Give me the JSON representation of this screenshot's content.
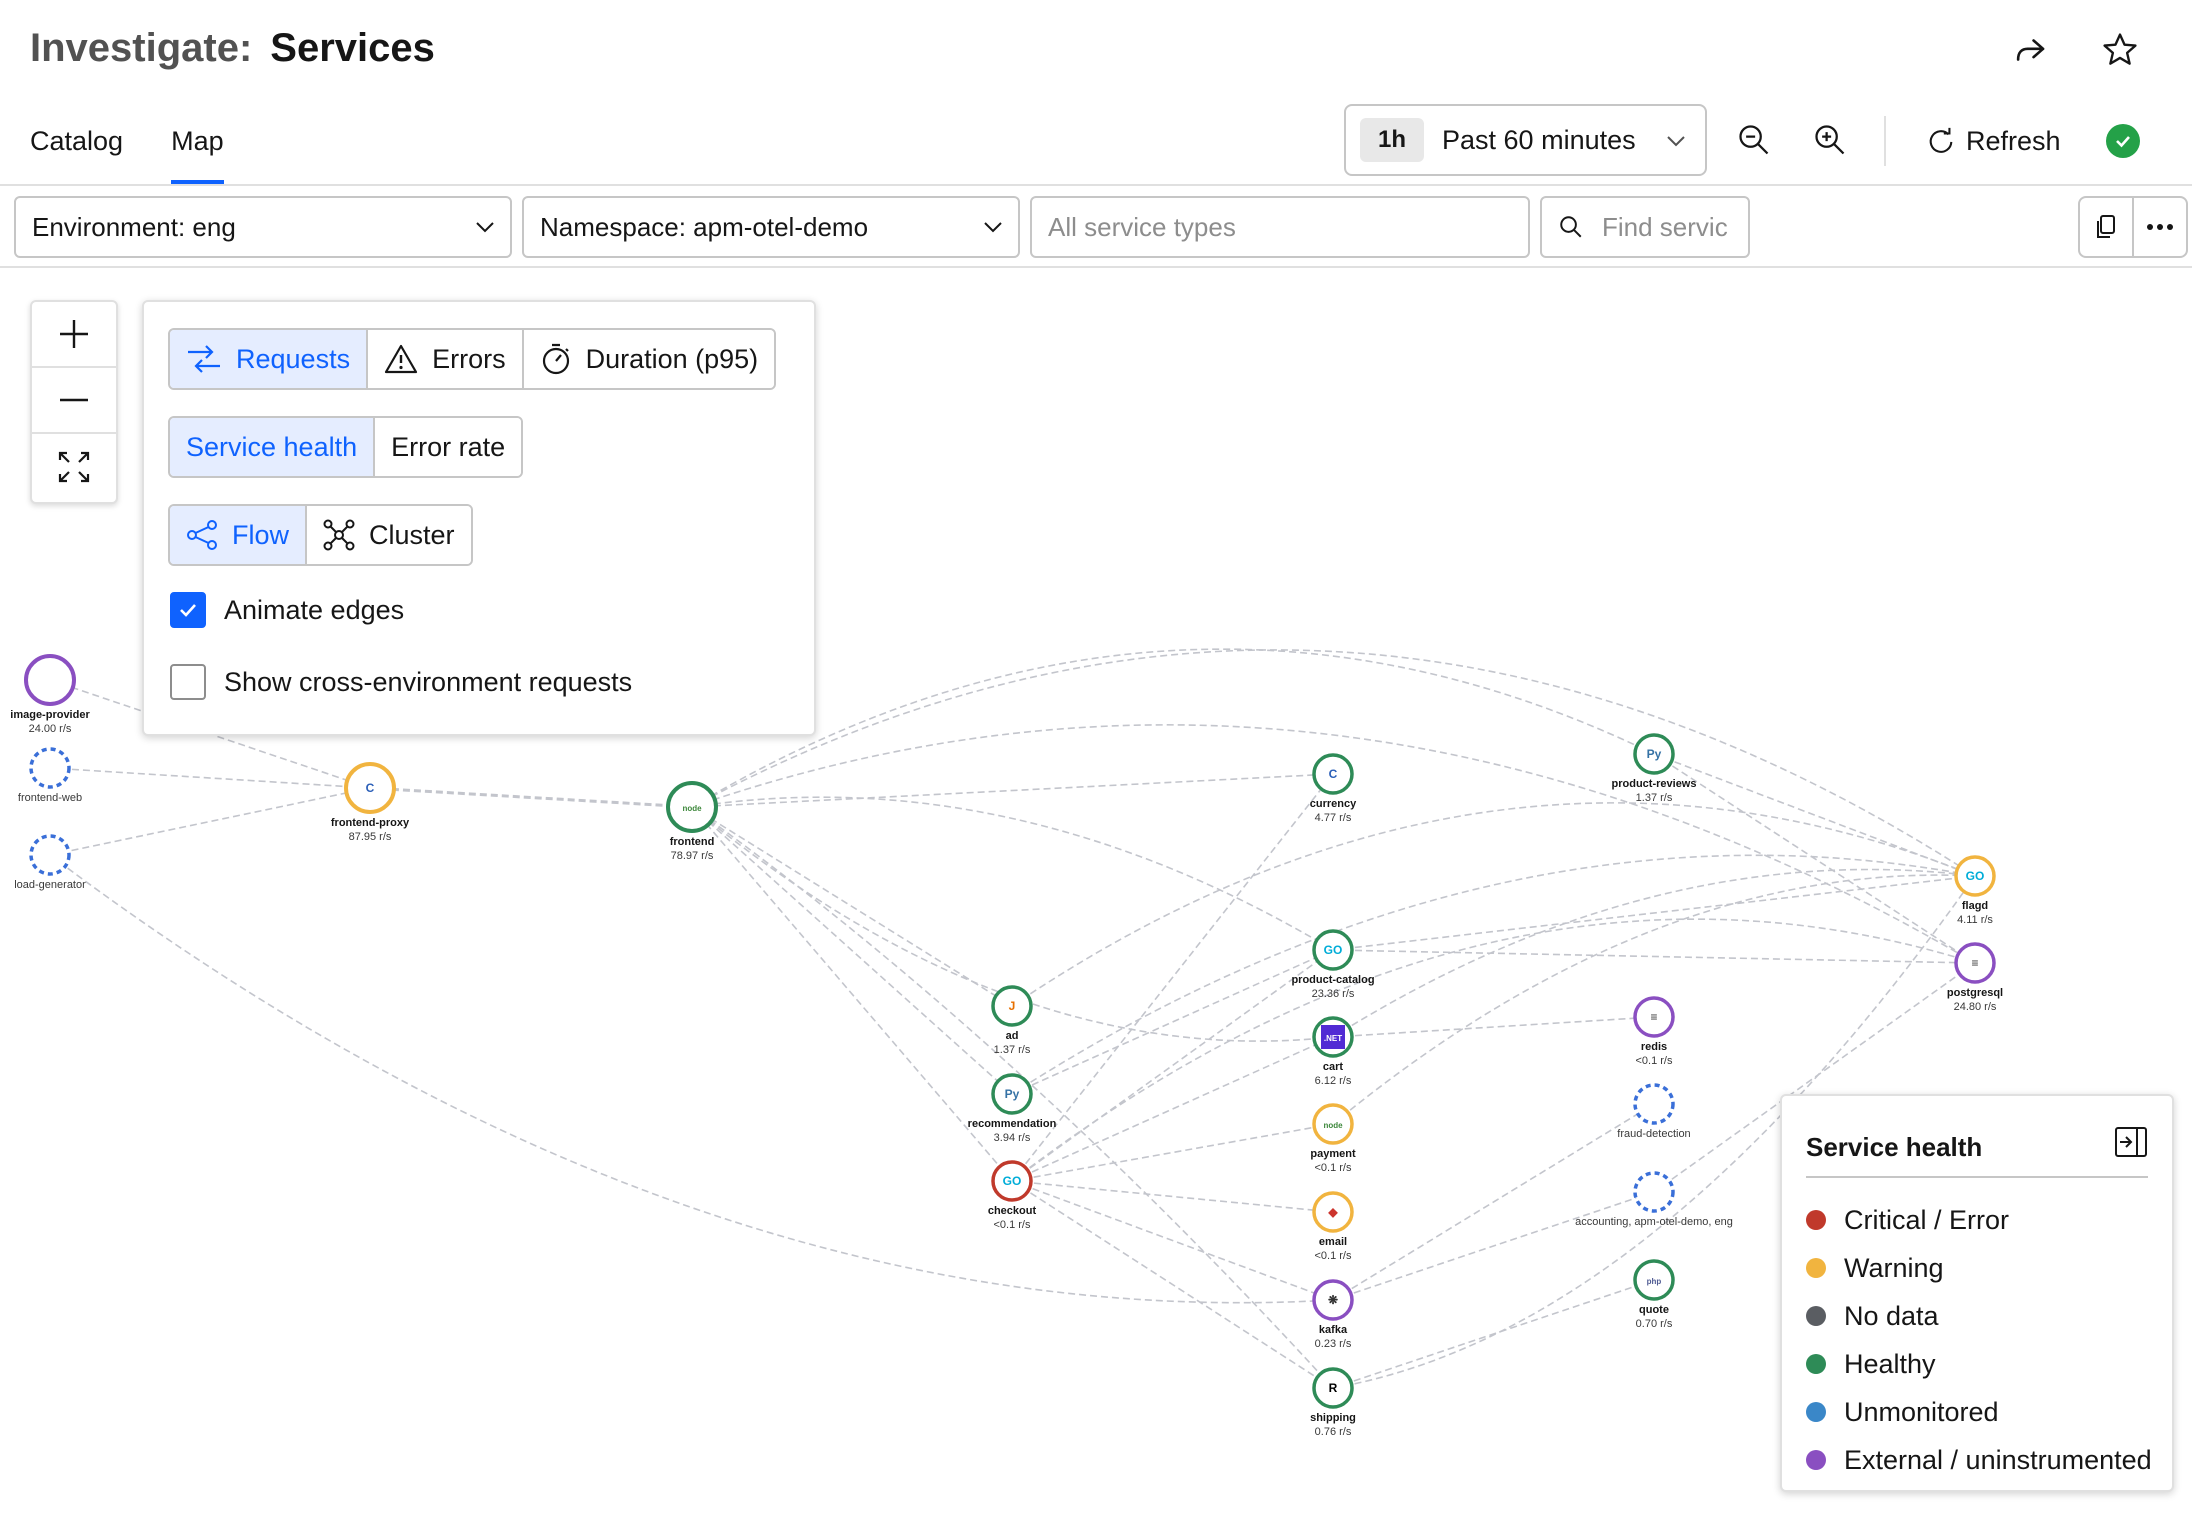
{
  "header": {
    "title_prefix": "Investigate:",
    "title_main": "Services",
    "share_icon": "share-icon",
    "star_icon": "star-icon"
  },
  "tabs": [
    {
      "label": "Catalog",
      "active": false
    },
    {
      "label": "Map",
      "active": true
    }
  ],
  "toolbar": {
    "time_chip": "1h",
    "time_range": "Past 60 minutes",
    "zoom_out_icon": "zoom-out-icon",
    "zoom_in_icon": "zoom-in-icon",
    "refresh_label": "Refresh",
    "status": "healthy"
  },
  "filters": {
    "environment": "Environment: eng",
    "namespace": "Namespace: apm-otel-demo",
    "service_types_placeholder": "All service types",
    "find_placeholder": "Find servic"
  },
  "map_controls": {
    "zoom_in": "+",
    "zoom_out": "−",
    "fit_icon": "fit-to-screen-icon"
  },
  "options_panel": {
    "metric_buttons": [
      {
        "label": "Requests",
        "icon": "requests-icon",
        "active": true
      },
      {
        "label": "Errors",
        "icon": "warning-icon",
        "active": false
      },
      {
        "label": "Duration (p95)",
        "icon": "stopwatch-icon",
        "active": false
      }
    ],
    "color_buttons": [
      {
        "label": "Service health",
        "active": true
      },
      {
        "label": "Error rate",
        "active": false
      }
    ],
    "layout_buttons": [
      {
        "label": "Flow",
        "icon": "flow-icon",
        "active": true
      },
      {
        "label": "Cluster",
        "icon": "cluster-icon",
        "active": false
      }
    ],
    "animate_edges": {
      "label": "Animate edges",
      "checked": true
    },
    "cross_env": {
      "label": "Show cross-environment requests",
      "checked": false
    }
  },
  "nodes": [
    {
      "id": "image-provider",
      "label": "image-provider",
      "rate": "24.00 r/s",
      "status": "external"
    },
    {
      "id": "frontend-web",
      "label": "frontend-web",
      "rate": "",
      "status": "unmonitored"
    },
    {
      "id": "load-generator",
      "label": "load-generator",
      "rate": "",
      "status": "unmonitored"
    },
    {
      "id": "frontend-proxy",
      "label": "frontend-proxy",
      "rate": "87.95 r/s",
      "status": "warning",
      "icon": "cpp-icon"
    },
    {
      "id": "frontend",
      "label": "frontend",
      "rate": "78.97 r/s",
      "status": "healthy",
      "icon": "node-icon"
    },
    {
      "id": "ad",
      "label": "ad",
      "rate": "1.37 r/s",
      "status": "healthy",
      "icon": "java-icon"
    },
    {
      "id": "recommendation",
      "label": "recommendation",
      "rate": "3.94 r/s",
      "status": "healthy",
      "icon": "python-icon"
    },
    {
      "id": "checkout",
      "label": "checkout",
      "rate": "<0.1 r/s",
      "status": "critical",
      "icon": "go-icon"
    },
    {
      "id": "currency",
      "label": "currency",
      "rate": "4.77 r/s",
      "status": "healthy",
      "icon": "cpp-icon"
    },
    {
      "id": "product-catalog",
      "label": "product-catalog",
      "rate": "23.36 r/s",
      "status": "healthy",
      "icon": "go-icon"
    },
    {
      "id": "cart",
      "label": "cart",
      "rate": "6.12 r/s",
      "status": "healthy",
      "icon": "dotnet-icon"
    },
    {
      "id": "payment",
      "label": "payment",
      "rate": "<0.1 r/s",
      "status": "warning",
      "icon": "node-icon"
    },
    {
      "id": "email",
      "label": "email",
      "rate": "<0.1 r/s",
      "status": "warning",
      "icon": "ruby-icon"
    },
    {
      "id": "kafka",
      "label": "kafka",
      "rate": "0.23 r/s",
      "status": "external",
      "icon": "kafka-icon"
    },
    {
      "id": "shipping",
      "label": "shipping",
      "rate": "0.76 r/s",
      "status": "healthy",
      "icon": "rust-icon"
    },
    {
      "id": "product-reviews",
      "label": "product-reviews",
      "rate": "1.37 r/s",
      "status": "healthy",
      "icon": "python-icon"
    },
    {
      "id": "redis",
      "label": "redis",
      "rate": "<0.1 r/s",
      "status": "external",
      "icon": "database-icon"
    },
    {
      "id": "fraud-detection",
      "label": "fraud-detection",
      "rate": "",
      "status": "unmonitored"
    },
    {
      "id": "accounting",
      "label": "accounting, apm-otel-demo, eng",
      "rate": "",
      "status": "unmonitored"
    },
    {
      "id": "quote",
      "label": "quote",
      "rate": "0.70 r/s",
      "status": "healthy",
      "icon": "php-icon"
    },
    {
      "id": "flagd",
      "label": "flagd",
      "rate": "4.11 r/s",
      "status": "warning",
      "icon": "go-icon"
    },
    {
      "id": "postgresql",
      "label": "postgresql",
      "rate": "24.80 r/s",
      "status": "external",
      "icon": "database-icon"
    }
  ],
  "legend": {
    "title": "Service health",
    "collapse_icon": "collapse-panel-icon",
    "items": [
      {
        "label": "Critical / Error",
        "color": "#c0392b"
      },
      {
        "label": "Warning",
        "color": "#f1b43f"
      },
      {
        "label": "No data",
        "color": "#5a5d62"
      },
      {
        "label": "Healthy",
        "color": "#2e8b57"
      },
      {
        "label": "Unmonitored",
        "color": "#3a87c8"
      },
      {
        "label": "External / uninstrumented",
        "color": "#8a4fc1"
      }
    ]
  },
  "colors": {
    "accent": "#0f62fe",
    "healthy": "#2e8b57",
    "warning": "#f1b43f",
    "critical": "#c0392b",
    "external": "#8a4fc1",
    "unmonitored": "#3a6fd8",
    "edge": "#c3c5cc"
  }
}
